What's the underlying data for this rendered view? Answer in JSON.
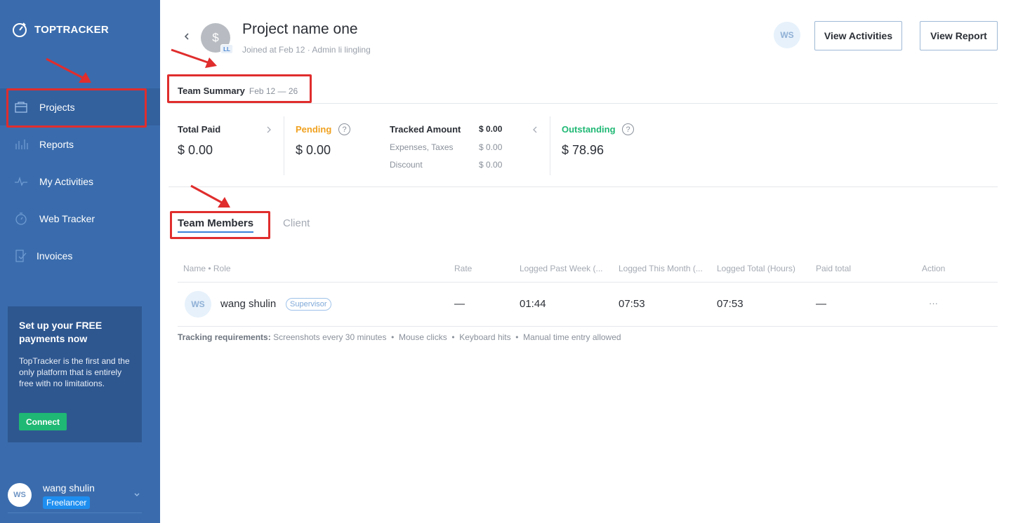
{
  "brand": {
    "name": "TOPTRACKER"
  },
  "sidebar": {
    "items": [
      {
        "label": "Projects",
        "icon": "projects-icon",
        "active": true
      },
      {
        "label": "Reports",
        "icon": "reports-icon"
      },
      {
        "label": "My Activities",
        "icon": "activities-icon"
      },
      {
        "label": "Web Tracker",
        "icon": "stopwatch-icon"
      },
      {
        "label": "Invoices",
        "icon": "invoices-icon"
      }
    ],
    "promo": {
      "title": "Set up your FREE payments now",
      "body": "TopTracker is the first and the only platform that is entirely free with no limitations.",
      "cta": "Connect"
    },
    "user": {
      "initials": "WS",
      "name": "wang shulin",
      "role": "Freelancer"
    }
  },
  "header": {
    "avatar_symbol": "$",
    "avatar_badge": "LL",
    "title": "Project name one",
    "subtitle": "Joined at Feb 12 · Admin li lingling",
    "user_initials": "WS",
    "view_activities": "View Activities",
    "view_report": "View Report"
  },
  "summary": {
    "title": "Team Summary",
    "range": "Feb 12 — 26",
    "total_paid": {
      "label": "Total Paid",
      "value": "$ 0.00"
    },
    "pending": {
      "label": "Pending",
      "value": "$ 0.00",
      "help": "?"
    },
    "tracked": {
      "label": "Tracked Amount",
      "value": "$ 0.00",
      "expenses_label": "Expenses, Taxes",
      "expenses_value": "$ 0.00",
      "discount_label": "Discount",
      "discount_value": "$ 0.00"
    },
    "outstanding": {
      "label": "Outstanding",
      "value": "$ 78.96",
      "help": "?"
    }
  },
  "tabs": [
    {
      "label": "Team Members",
      "active": true
    },
    {
      "label": "Client"
    }
  ],
  "table": {
    "headers": [
      "Name • Role",
      "Rate",
      "Logged Past Week (...",
      "Logged This Month (...",
      "Logged Total (Hours)",
      "Paid total",
      "Action"
    ],
    "rows": [
      {
        "initials": "WS",
        "name": "wang shulin",
        "role": "Supervisor",
        "rate": "—",
        "past_week": "01:44",
        "this_month": "07:53",
        "total": "07:53",
        "paid_total": "—",
        "action": "···"
      }
    ]
  },
  "requirements": {
    "label": "Tracking requirements:",
    "items": "Screenshots every 30 minutes  •  Mouse clicks  •  Keyboard hits  •  Manual time entry allowed"
  },
  "colors": {
    "sidebar": "#3a6cad",
    "pending": "#f0a11f",
    "outstanding": "#1fb874",
    "accent": "#3b82d6",
    "annotation": "#e02d2d"
  }
}
